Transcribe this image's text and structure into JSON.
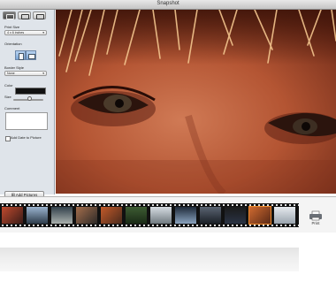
{
  "window": {
    "title": "Snapshot"
  },
  "sidebar": {
    "print_size_label": "Print Size",
    "print_size_value": "4 x 6 inches",
    "orientation_label": "Orientation",
    "border_style_label": "Border Style",
    "border_style_value": "None",
    "color_label": "Color",
    "size_label": "Size",
    "size_level": 0.55,
    "comment_label": "Comment",
    "comment_value": "",
    "add_date_label": "Add Date to Picture",
    "add_date_checked": false,
    "add_pictures_label": "Add Pictures"
  },
  "toolbar": {
    "print_label": "Print"
  },
  "colors": {
    "border_color": "#111111",
    "selection_outline": "#f08a2a"
  }
}
